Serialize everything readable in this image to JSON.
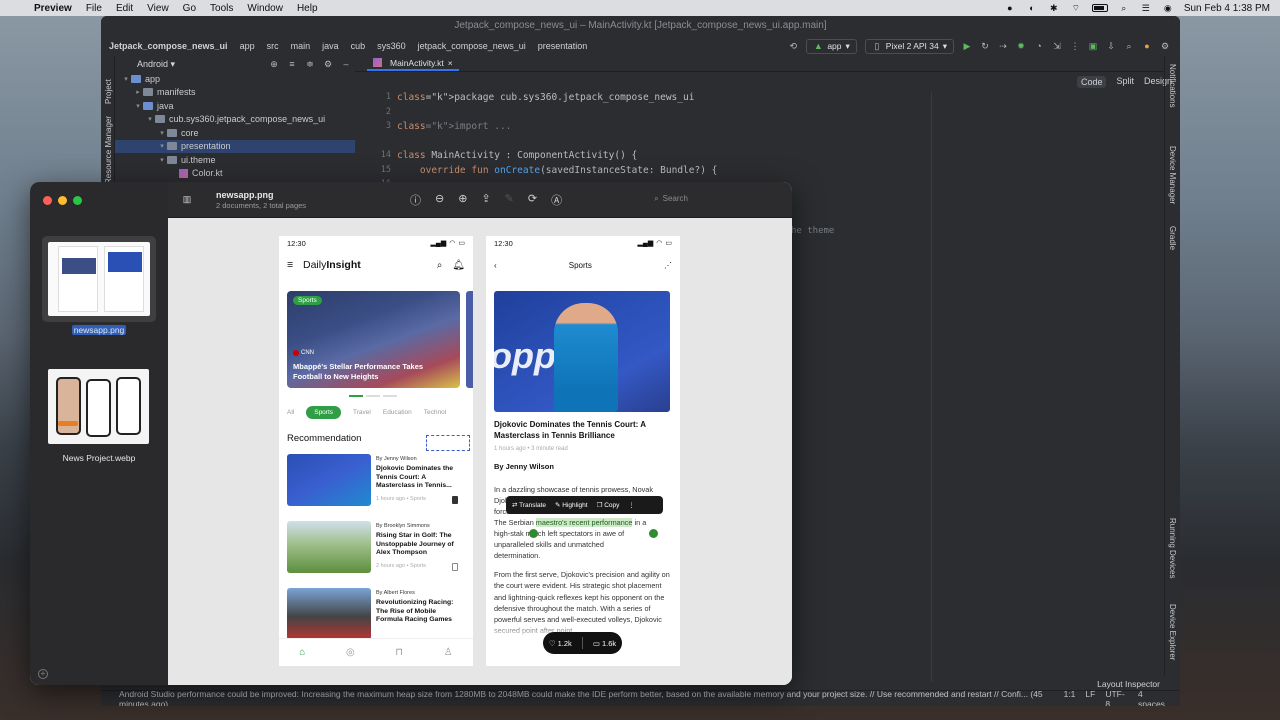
{
  "menubar": {
    "app": "Preview",
    "items": [
      "File",
      "Edit",
      "View",
      "Go",
      "Tools",
      "Window",
      "Help"
    ],
    "clock": "Sun Feb 4  1:38 PM"
  },
  "ide": {
    "title": "Jetpack_compose_news_ui – MainActivity.kt [Jetpack_compose_news_ui.app.main]",
    "breadcrumb": [
      "Jetpack_compose_news_ui",
      "app",
      "src",
      "main",
      "java",
      "cub",
      "sys360",
      "jetpack_compose_news_ui",
      "presentation"
    ],
    "run_config": "app",
    "device": "Pixel 2 API 34",
    "project_view": "Android",
    "side_left": [
      "Project",
      "Resource Manager"
    ],
    "side_right": [
      "Notifications",
      "Device Manager",
      "Gradle",
      "Running Devices",
      "Device Explorer"
    ],
    "tree": [
      {
        "label": "app",
        "level": 0,
        "kind": "folder-blue"
      },
      {
        "label": "manifests",
        "level": 1,
        "kind": "folder"
      },
      {
        "label": "java",
        "level": 1,
        "kind": "folder-blue"
      },
      {
        "label": "cub.sys360.jetpack_compose_news_ui",
        "level": 2,
        "kind": "folder"
      },
      {
        "label": "core",
        "level": 3,
        "kind": "folder"
      },
      {
        "label": "presentation",
        "level": 3,
        "kind": "folder",
        "selected": true
      },
      {
        "label": "ui.theme",
        "level": 3,
        "kind": "folder"
      },
      {
        "label": "Color.kt",
        "level": 4,
        "kind": "kt"
      }
    ],
    "tab": "MainActivity.kt",
    "view_modes": [
      "Code",
      "Split",
      "Design"
    ],
    "line_numbers": [
      "1",
      "2",
      "3",
      "",
      "14",
      "15",
      "16"
    ],
    "code_lines": [
      "package cub.sys360.jetpack_compose_news_ui",
      "",
      "import ...",
      "",
      "class MainActivity : ComponentActivity() {",
      "    override fun onCreate(savedInstanceState: Bundle?) {"
    ],
    "code_fragment": "he theme",
    "layout_inspector": "Layout Inspector",
    "status_message": "Android Studio performance could be improved: Increasing the maximum heap size from 1280MB to 2048MB could make the IDE perform better, based on the available memory and your project size. // Use recommended and restart // Confi... (45 minutes ago)",
    "status_right": [
      "1:1",
      "LF",
      "UTF-8",
      "4 spaces"
    ]
  },
  "preview": {
    "file": "newsapp.png",
    "subtitle": "2 documents, 2 total pages",
    "search_placeholder": "Search",
    "thumbs": [
      "newsapp.png",
      "News Project.webp"
    ]
  },
  "phone1": {
    "time": "12:30",
    "brand_a": "Daily",
    "brand_b": "Insight",
    "hero": {
      "tag": "Sports",
      "source": "CNN",
      "title": "Mbappé's Stellar Performance Takes Football to New Heights"
    },
    "categories": [
      "All",
      "Sports",
      "Travel",
      "Education",
      "Technol"
    ],
    "section": "Recommendation",
    "articles": [
      {
        "by": "By Jenny Wilson",
        "title": "Djokovic Dominates the Tennis Court: A Masterclass in Tennis...",
        "meta": "1 hours ago • Sports"
      },
      {
        "by": "By Brooklyn Simmons",
        "title": "Rising Star in Golf: The Unstoppable Journey of Alex Thompson",
        "meta": "2 hours ago • Sports"
      },
      {
        "by": "By Albert Flores",
        "title": "Revolutionizing Racing: The Rise of Mobile Formula Racing Games",
        "meta": ""
      }
    ]
  },
  "phone2": {
    "time": "12:30",
    "header": "Sports",
    "title": "Djokovic Dominates the Tennis Court: A Masterclass in Tennis Brilliance",
    "meta": "1 hours ago • 3 minute read",
    "byline": "By Jenny Wilson",
    "hero_brand": "opp",
    "p1_a": "In a dazzling showcase of tennis prowess, Novak",
    "p1_b": "Djok",
    "p1_c": "force",
    "p1_d_pre": "The Serbian ",
    "p1_d_hl": "maestro's recent performance",
    "p1_d_post": " in a",
    "p1_e": "high-stak  match left spectators in awe of",
    "p1_f": "unparalleled skills and unmatched",
    "p1_g": "determination.",
    "p2": "From the first serve, Djokovic's precision and agility on the court were evident. His strategic shot placement and lightning-quick reflexes kept his opponent on the defensive throughout the match. With a series of powerful serves and well-executed volleys, Djokovic secured point after point",
    "popup": [
      "Translate",
      "Highlight",
      "Copy"
    ],
    "likes": "1.2k",
    "comments": "1.6k"
  }
}
